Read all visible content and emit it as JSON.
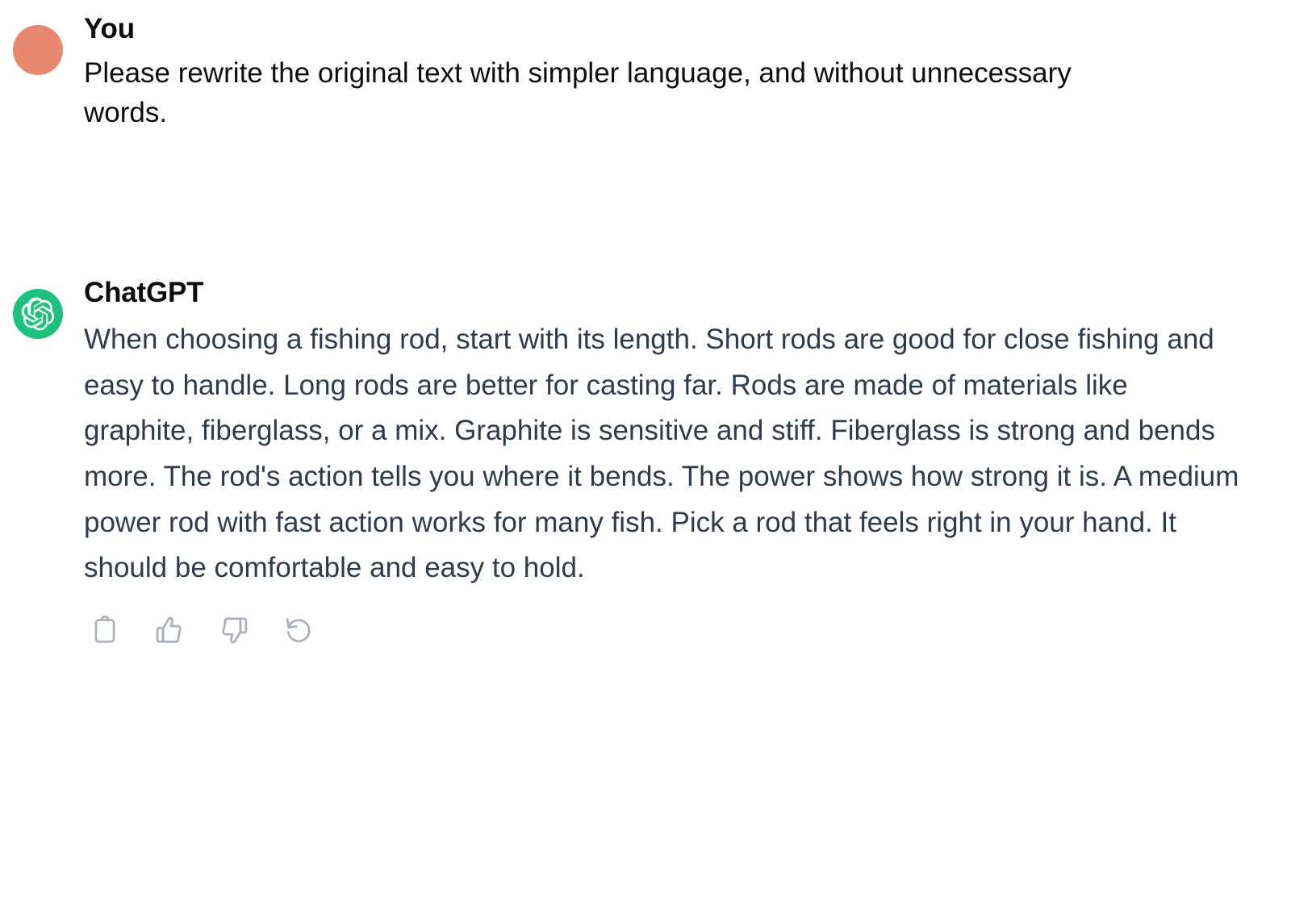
{
  "conversation": {
    "messages": [
      {
        "role": "user",
        "sender_label": "You",
        "avatar_icon": "user-avatar-circle",
        "avatar_color": "#e8886f",
        "text": "Please rewrite the original text with simpler language, and without unnecessary words."
      },
      {
        "role": "assistant",
        "sender_label": "ChatGPT",
        "avatar_icon": "openai-logo-icon",
        "avatar_color": "#19c37d",
        "text": "When choosing a fishing rod, start with its length. Short rods are good for close fishing and easy to handle. Long rods are better for casting far. Rods are made of materials like graphite, fiberglass, or a mix. Graphite is sensitive and stiff. Fiberglass is strong and bends more. The rod's action tells you where it bends. The power shows how strong it is. A medium power rod with fast action works for many fish. Pick a rod that feels right in your hand. It should be comfortable and easy to hold."
      }
    ]
  },
  "actions": [
    {
      "name": "copy-button",
      "icon": "clipboard-icon",
      "label": "Copy"
    },
    {
      "name": "thumbs-up-button",
      "icon": "thumbs-up-icon",
      "label": "Good response"
    },
    {
      "name": "thumbs-down-button",
      "icon": "thumbs-down-icon",
      "label": "Bad response"
    },
    {
      "name": "regenerate-button",
      "icon": "regenerate-icon",
      "label": "Regenerate"
    }
  ],
  "colors": {
    "background": "#ffffff",
    "user_text": "#0d0d0d",
    "assistant_text": "#2f3b4d",
    "icon": "#aaafc0",
    "user_avatar": "#e8886f",
    "assistant_avatar": "#19c37d"
  }
}
